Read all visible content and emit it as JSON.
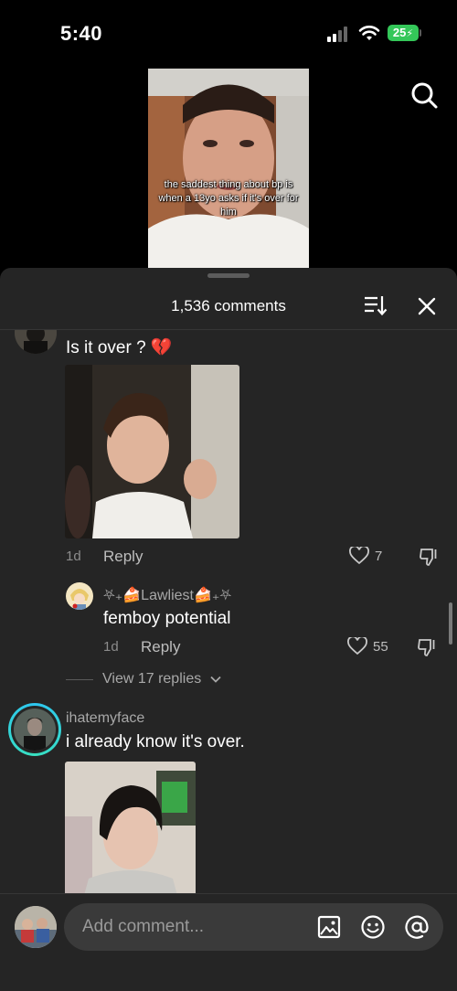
{
  "status_bar": {
    "time": "5:40",
    "battery": "25"
  },
  "video": {
    "caption": "the saddest thing about bp is when a 13yo asks if it's over for him"
  },
  "sheet": {
    "comment_count": "1,536 comments"
  },
  "comments": [
    {
      "text": "Is it over ? 💔",
      "time": "1d",
      "reply_label": "Reply",
      "likes": "7",
      "replies": [
        {
          "username": "⛧₊🍰Lawliest🍰₊⛧",
          "text": "femboy potential",
          "time": "1d",
          "reply_label": "Reply",
          "likes": "55"
        }
      ],
      "view_replies": "View 17 replies"
    },
    {
      "username": "ihatemyface",
      "text": "i already know it's over."
    }
  ],
  "composer": {
    "placeholder": "Add comment..."
  },
  "icons": [
    "search-icon",
    "sort-icon",
    "close-icon",
    "heart-icon",
    "dislike-icon",
    "chevron-down-icon",
    "image-icon",
    "emoji-icon",
    "mention-icon"
  ],
  "colors": {
    "sheet_bg": "#252525",
    "battery": "#34c759",
    "broken_heart": "#e0245e"
  }
}
